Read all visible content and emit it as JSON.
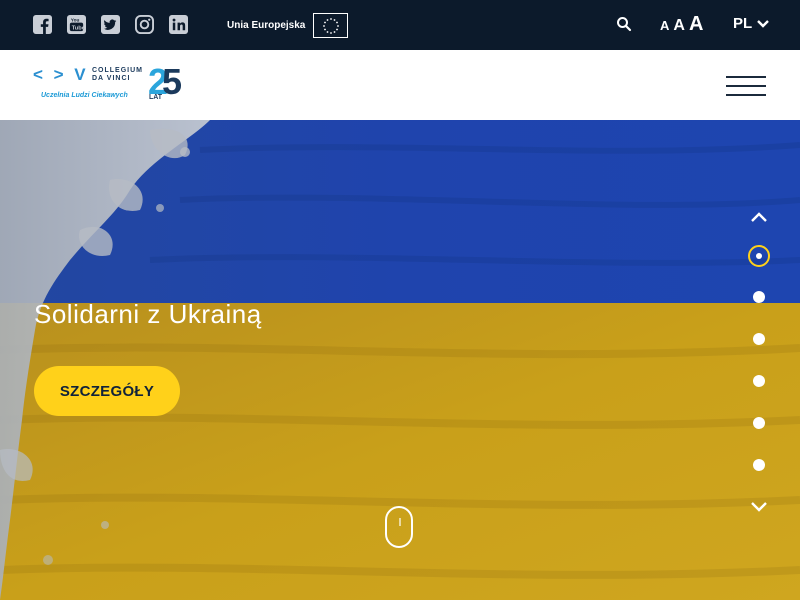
{
  "topbar": {
    "social_icons": [
      "facebook-icon",
      "youtube-icon",
      "twitter-icon",
      "instagram-icon",
      "linkedin-icon"
    ],
    "eu_label": "Unia Europejska",
    "font_size_labels": [
      "A",
      "A",
      "A"
    ],
    "language": "PL"
  },
  "header": {
    "logo": {
      "brand": "< > V",
      "name": "COLLEGIUM DA VINCI",
      "tagline": "Uczelnia Ludzi Ciekawych",
      "anniversary": "25",
      "anniversary_unit": "LAT"
    }
  },
  "hero": {
    "title": "Solidarni z Ukrainą",
    "cta_label": "SZCZEGÓŁY",
    "slides_count": 6,
    "active_slide": 1
  },
  "colors": {
    "topbar_bg": "#0c1a2b",
    "flag_blue": "#1e45a8",
    "flag_yellow": "#c9a01a",
    "cta_yellow": "#ffd11a"
  }
}
